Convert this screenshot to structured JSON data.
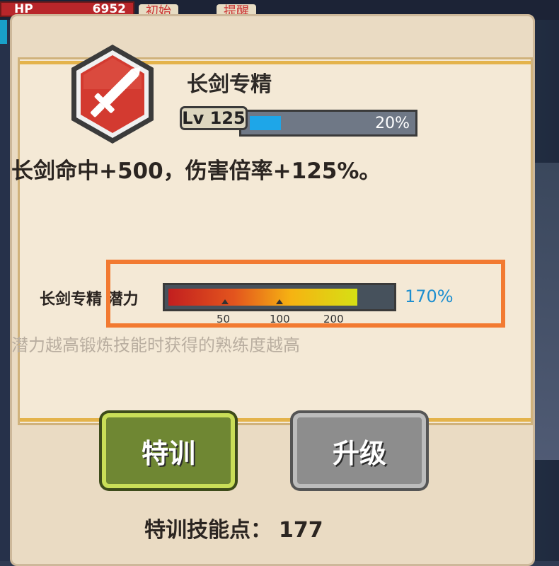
{
  "hud": {
    "hp_label": "HP",
    "hp_value": "6952",
    "tab_1": "初始",
    "tab_2": "提醒"
  },
  "skill": {
    "name": "长剑专精",
    "level_label": "Lv 125",
    "level_progress": 0.2,
    "level_progress_text": "20%",
    "description": "长剑命中+500，伤害倍率+125%。",
    "potential_label": "长剑专精 潜力",
    "potential_value": 1.7,
    "potential_text": "170%",
    "potential_max": 2.0,
    "potential_ticks": [
      "50",
      "100",
      "200"
    ],
    "hint": "潜力越高锻炼技能时获得的熟练度越高"
  },
  "actions": {
    "train_label": "特训",
    "upgrade_label": "升级"
  },
  "footer": {
    "points_label": "特训技能点：",
    "points_value": "177"
  },
  "colors": {
    "highlight": "#f27a31",
    "xp_fill": "#1ea6e8",
    "potential_value": "#1e8fd0",
    "train_button": "#6f8733",
    "upgrade_button": "#8d8d8d"
  },
  "icons": {
    "skill": "sword-icon"
  }
}
